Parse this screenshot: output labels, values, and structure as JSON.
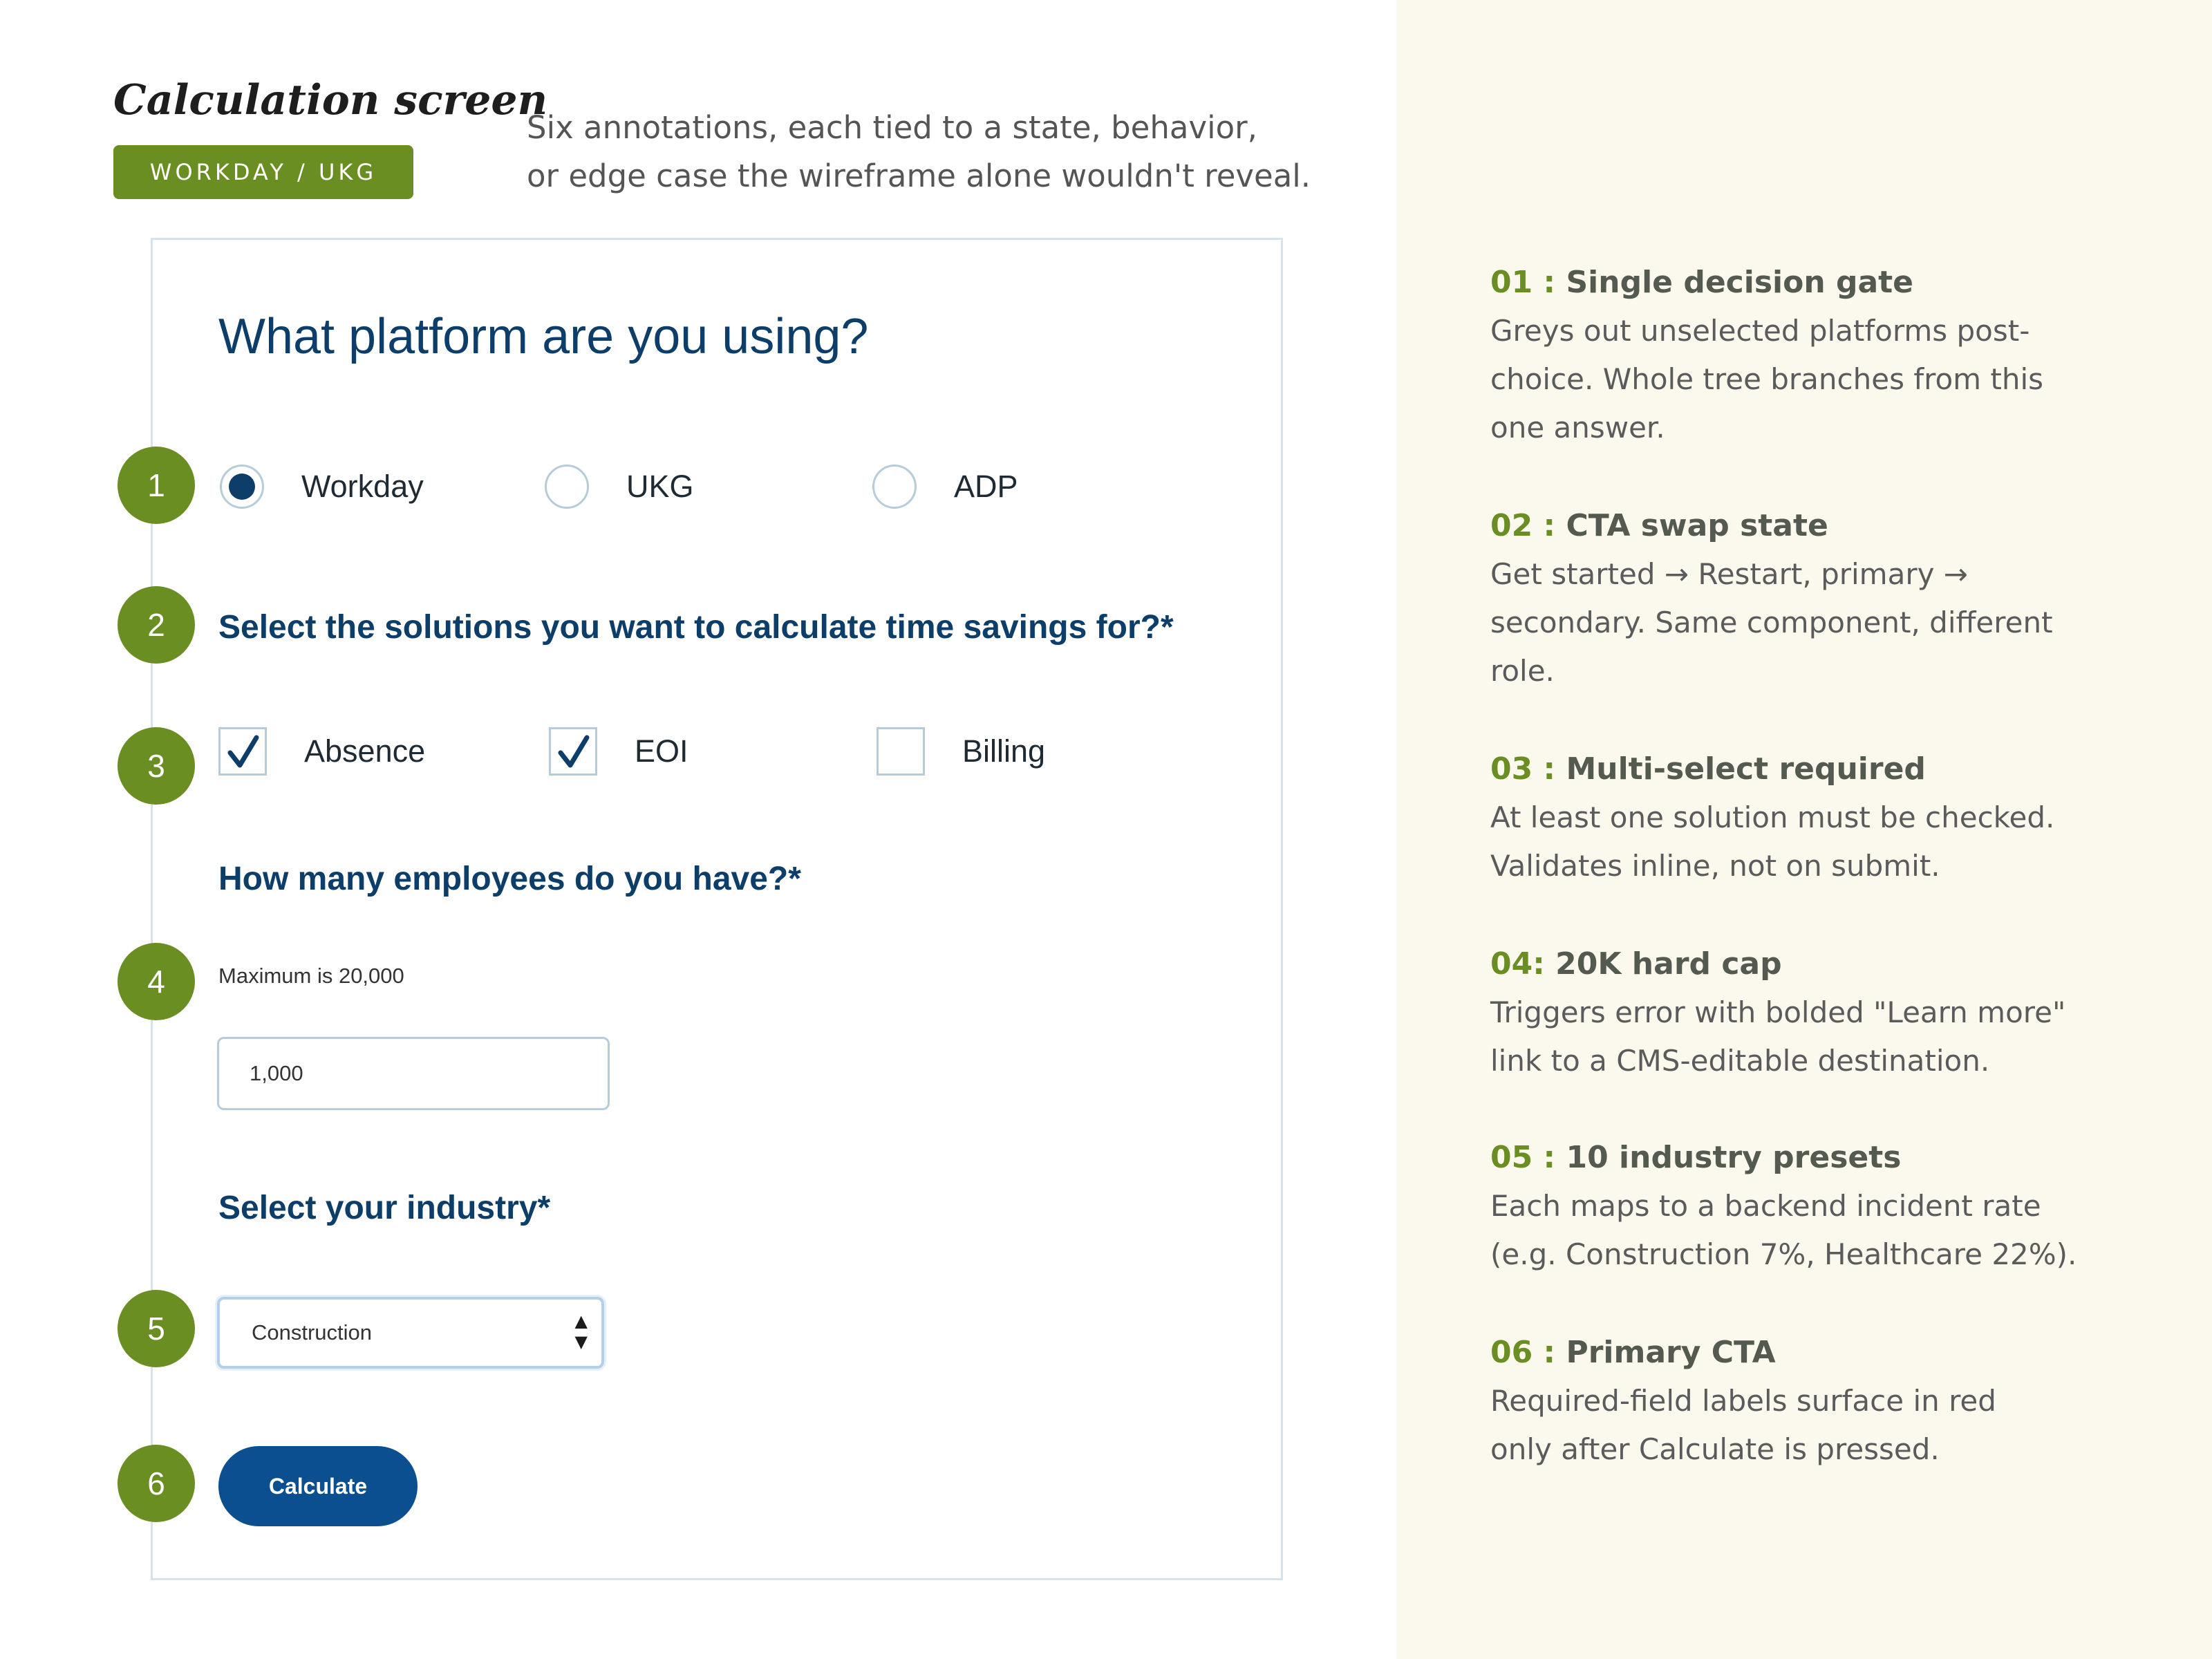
{
  "header": {
    "title": "Calculation screen",
    "tag": "WORKDAY / UKG",
    "intro_lines": [
      "Six annotations, each tied to a state, behavior,",
      "or edge case the wireframe alone wouldn't reveal."
    ]
  },
  "form": {
    "question": "What platform are you using?",
    "platforms": [
      {
        "label": "Workday",
        "selected": true
      },
      {
        "label": "UKG",
        "selected": false
      },
      {
        "label": "ADP",
        "selected": false
      }
    ],
    "solutions_question": "Select the solutions you want to calculate time savings for?*",
    "solutions": [
      {
        "label": "Absence",
        "checked": true
      },
      {
        "label": "EOI",
        "checked": true
      },
      {
        "label": "Billing",
        "checked": false
      }
    ],
    "employees_question": "How many employees do you have?*",
    "employees_hint": "Maximum is 20,000",
    "employees_value": "1,000",
    "industry_question": "Select your industry*",
    "industry_selected": "Construction",
    "calculate_label": "Calculate"
  },
  "steps": [
    "1",
    "2",
    "3",
    "4",
    "5",
    "6"
  ],
  "colors": {
    "accent_green": "#6b8e23",
    "navy": "#0d3e6a",
    "button_blue": "#0b4f91",
    "panel_bg": "#fbf9ee"
  },
  "annotations": [
    {
      "number": "01 :",
      "title": "Single decision gate",
      "lines": [
        "Greys out unselected platforms post-",
        "choice. Whole tree branches from this",
        "one answer."
      ]
    },
    {
      "number": "02 :",
      "title": "CTA swap state",
      "lines": [
        "Get started → Restart, primary →",
        "secondary. Same component, different",
        "role."
      ]
    },
    {
      "number": "03 :",
      "title": "Multi-select required",
      "lines": [
        "At least one solution must be checked.",
        "Validates inline, not on submit."
      ]
    },
    {
      "number": "04:",
      "title": "20K hard cap",
      "lines": [
        "Triggers error with bolded \"Learn more\"",
        "link to a CMS-editable destination."
      ]
    },
    {
      "number": "05 :",
      "title": "10 industry presets",
      "lines": [
        "Each maps to a backend incident rate",
        "(e.g. Construction 7%, Healthcare 22%)."
      ]
    },
    {
      "number": "06 :",
      "title": "Primary CTA",
      "lines": [
        "Required-field labels surface in red",
        "only after Calculate is pressed."
      ]
    }
  ]
}
